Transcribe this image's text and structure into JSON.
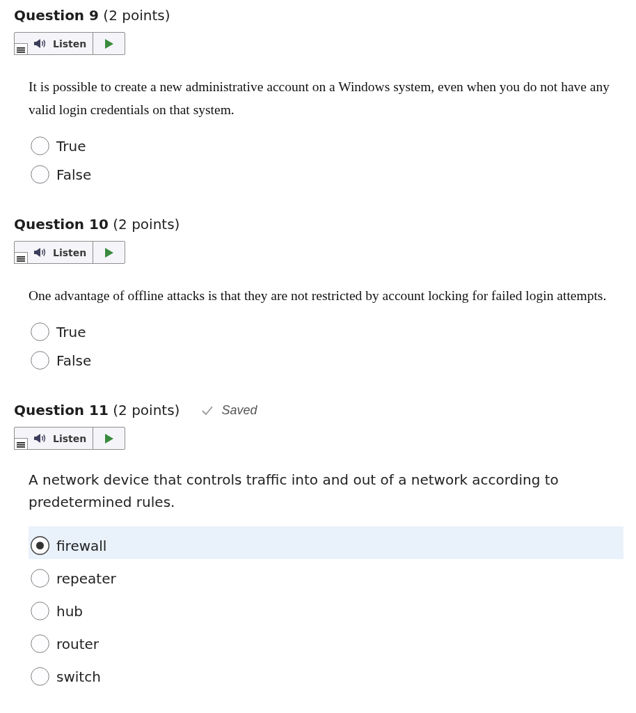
{
  "questions": [
    {
      "title": "**Question 9** (2 points)",
      "kind": "true_false",
      "listen": {
        "label": "Listen"
      },
      "prompt": "It is possible to create a new administrative account on a Windows system, even when you do not have any valid login credentials on that system.",
      "options": [
        {
          "label": "True",
          "selected": false
        },
        {
          "label": "False",
          "selected": false
        }
      ]
    },
    {
      "title": "**Question 10** (2 points)",
      "kind": "true_false",
      "listen": {
        "label": "Listen"
      },
      "prompt": "One advantage of offline attacks is that they are not restricted by account locking for failed login attempts.",
      "options": [
        {
          "label": "True",
          "selected": false
        },
        {
          "label": "False",
          "selected": false
        }
      ]
    },
    {
      "title": "**Question 11** (2 points)",
      "kind": "multiple_choice",
      "status": "Saved",
      "listen": {
        "label": "Listen"
      },
      "prompt": "A network device that controls traffic into and out of a network according to predetermined rules.",
      "options": [
        {
          "label": "firewall",
          "selected": true
        },
        {
          "label": "repeater",
          "selected": false
        },
        {
          "label": "hub",
          "selected": false
        },
        {
          "label": "router",
          "selected": false
        },
        {
          "label": "switch",
          "selected": false
        }
      ]
    }
  ]
}
